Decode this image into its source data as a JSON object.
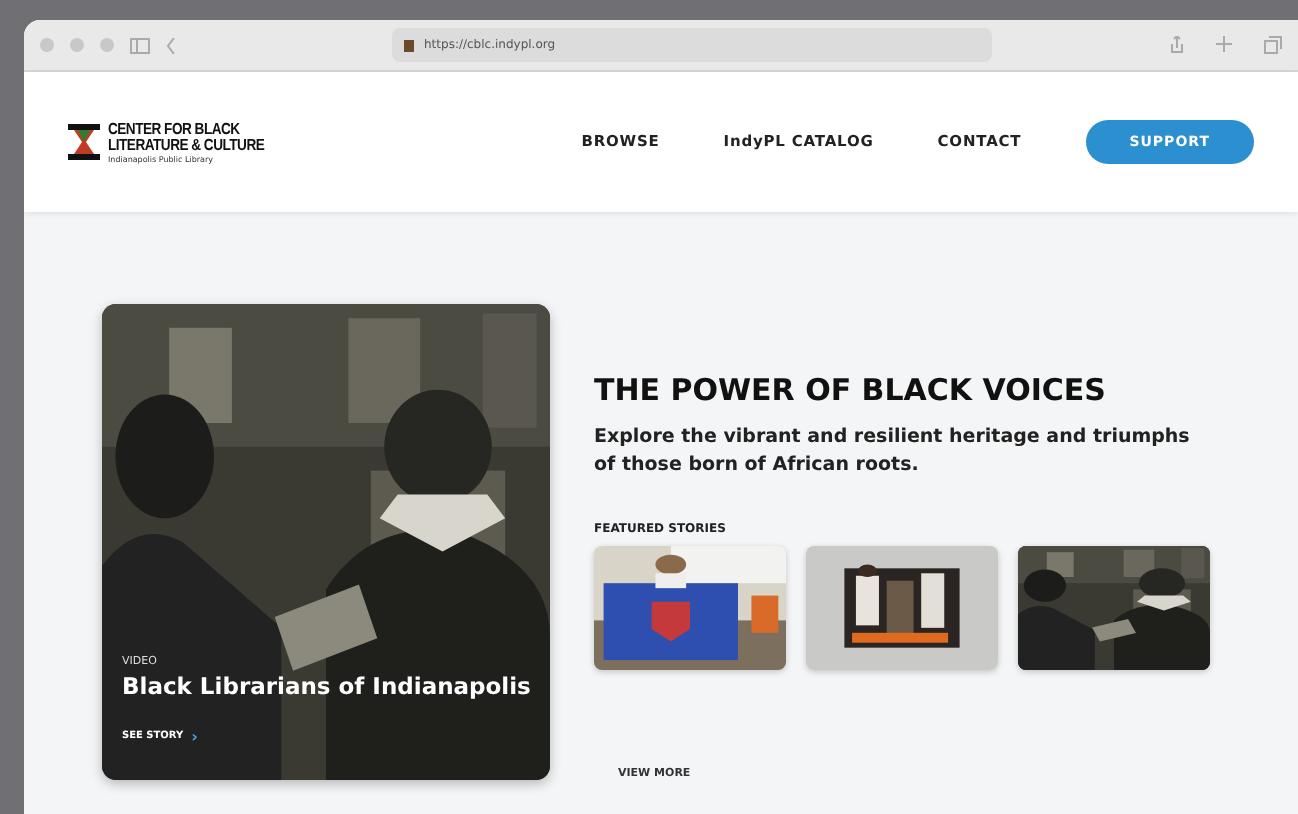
{
  "browser": {
    "url": "https://cblc.indypl.org"
  },
  "site": {
    "logo_lines": [
      "CENTER FOR BLACK",
      "LITERATURE & CULTURE"
    ],
    "logo_sub": "Indianapolis Public Library",
    "nav": [
      {
        "label": "BROWSE",
        "kind": "link"
      },
      {
        "label": "IndyPL CATALOG",
        "kind": "link"
      },
      {
        "label": "CONTACT",
        "kind": "link"
      },
      {
        "label": "SUPPORT",
        "kind": "button"
      }
    ]
  },
  "hero_card": {
    "kind": "picture",
    "tag": "VIDEO",
    "title": "Black Librarians of Indianapolis",
    "link": "SEE STORY",
    "arrow": "›"
  },
  "headline": "THE POWER OF BLACK VOICES",
  "intro": "Explore the vibrant and resilient heritage and triumphs of those born of African roots.",
  "featured": {
    "heading": "FEATURED STORIES",
    "more": "VIEW MORE"
  }
}
